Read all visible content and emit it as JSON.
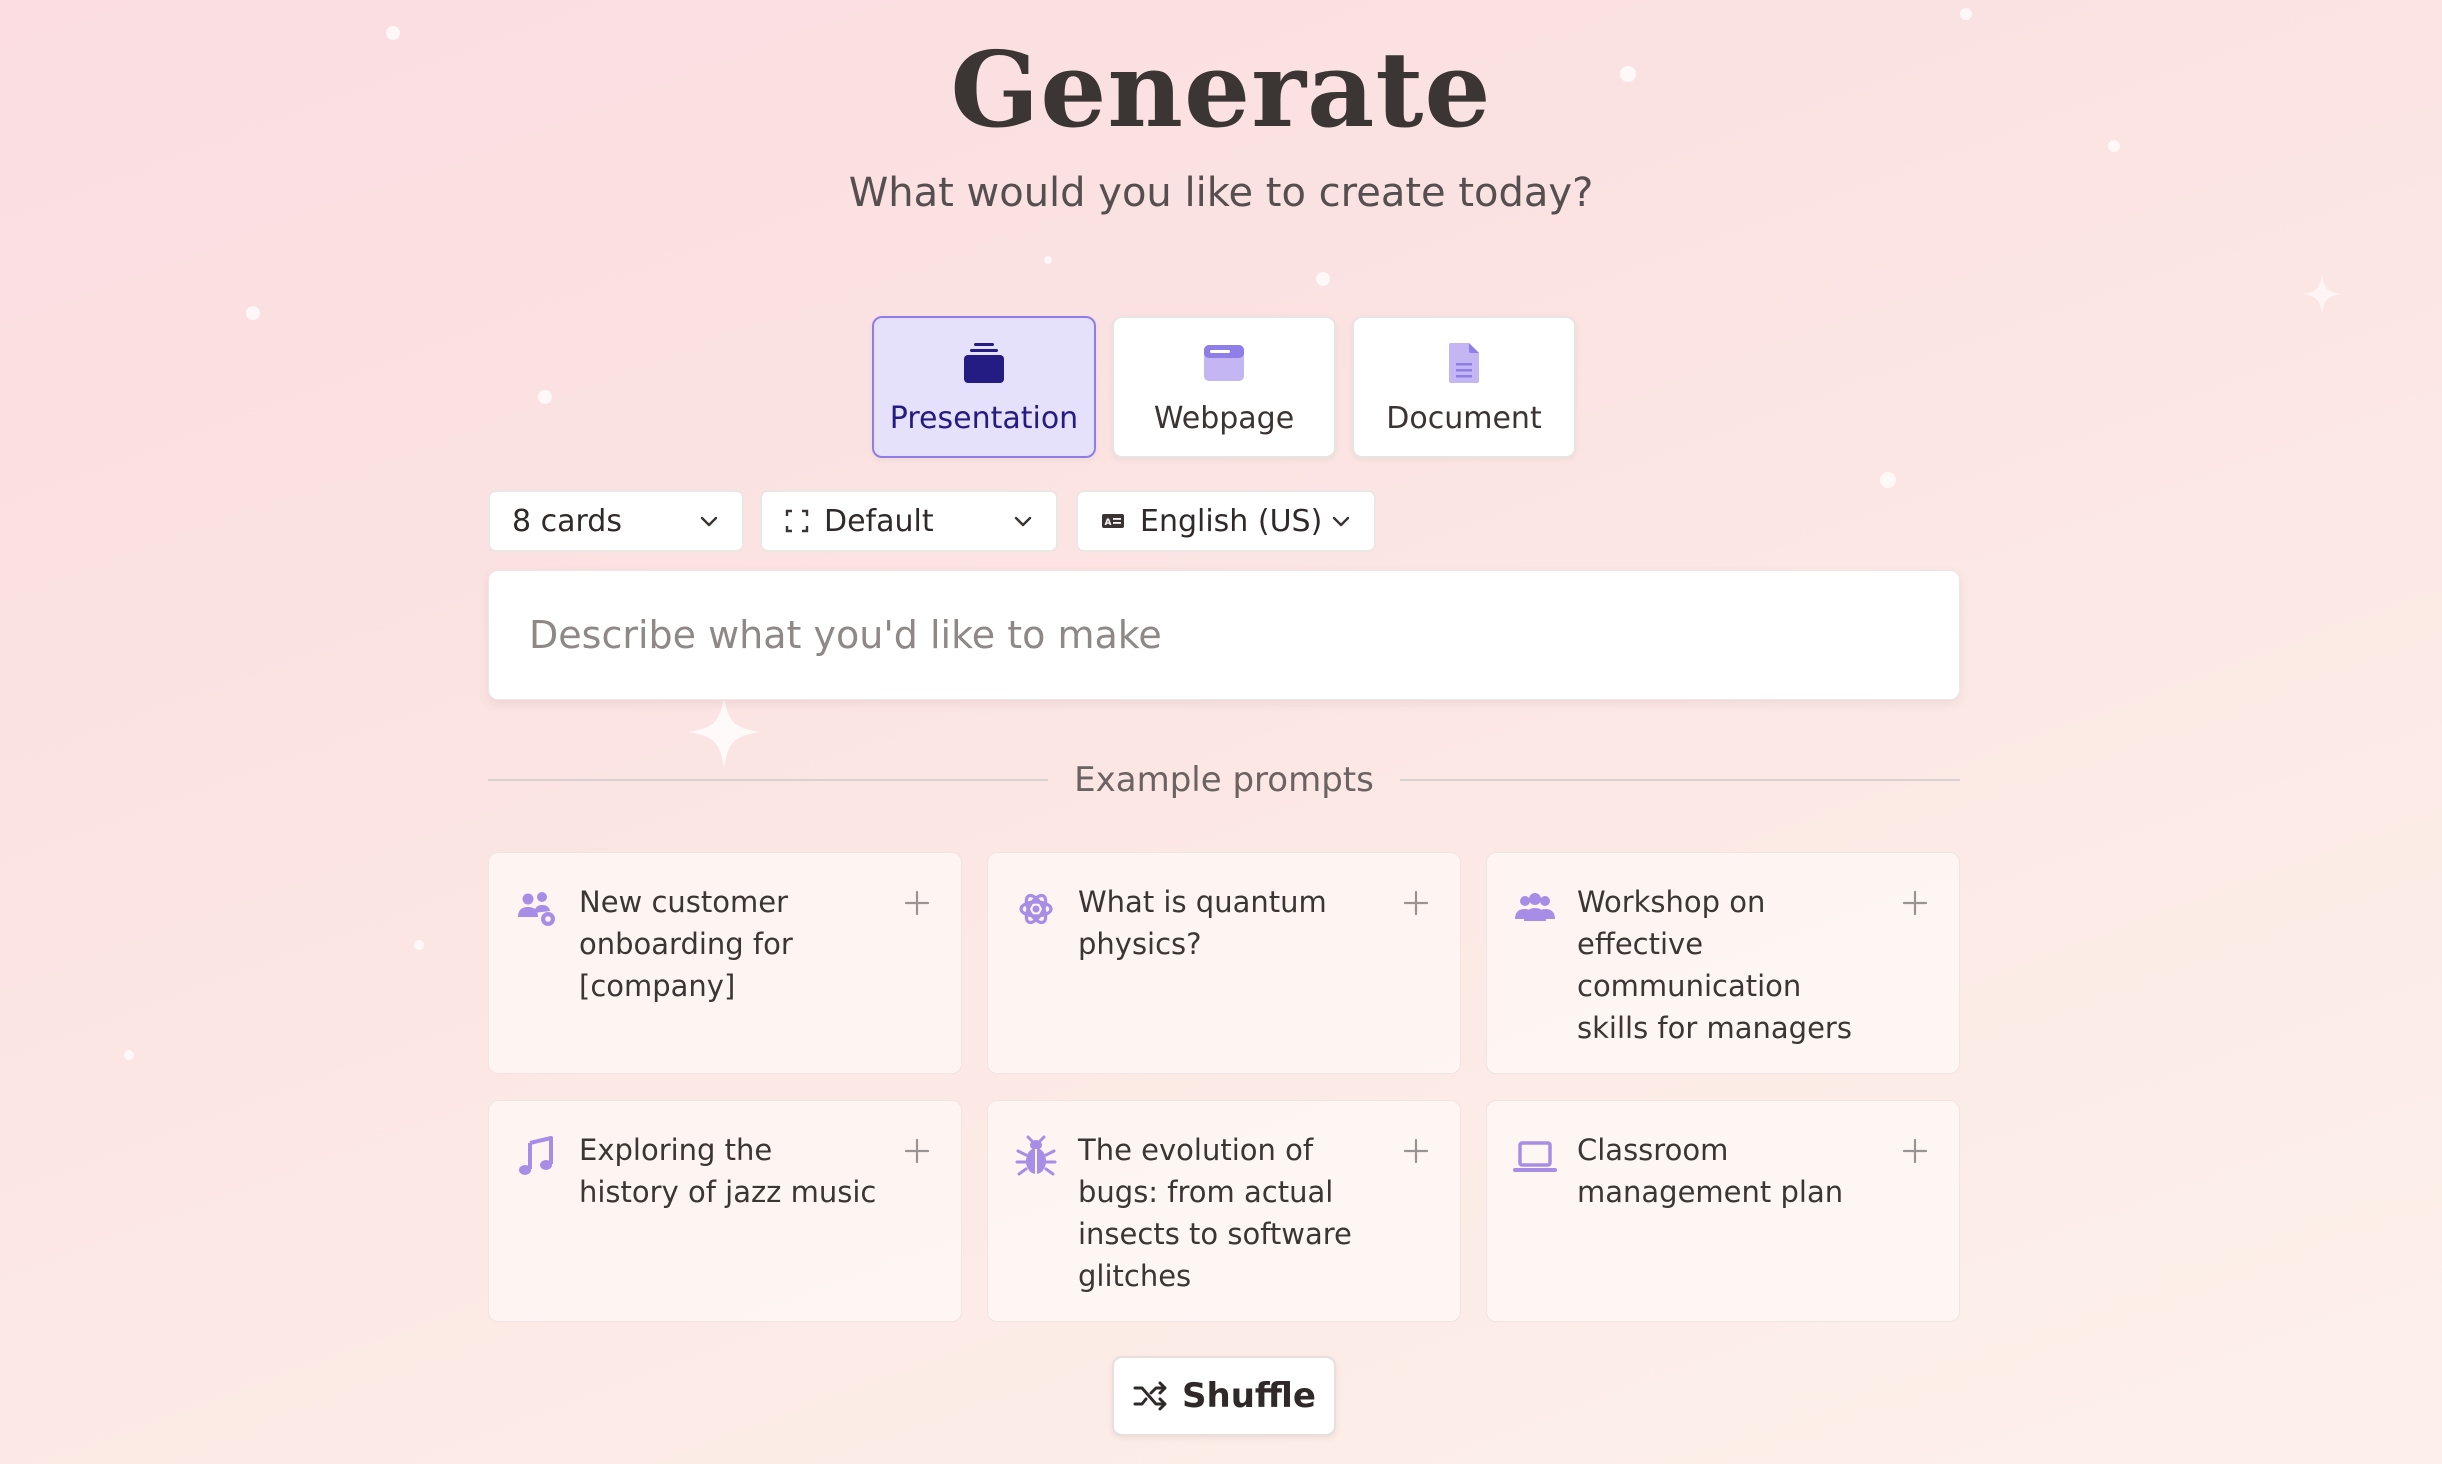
{
  "header": {
    "title": "Generate",
    "subtitle": "What would you like to create today?"
  },
  "content_types": [
    {
      "label": "Presentation",
      "icon": "stack-icon",
      "selected": true
    },
    {
      "label": "Webpage",
      "icon": "browser-window-icon",
      "selected": false
    },
    {
      "label": "Document",
      "icon": "document-icon",
      "selected": false
    }
  ],
  "options": {
    "cards": "8 cards",
    "theme": "Default",
    "language": "English (US)"
  },
  "prompt": {
    "placeholder": "Describe what you'd like to make",
    "value": ""
  },
  "examples": {
    "heading": "Example prompts",
    "items": [
      {
        "text": "New customer onboarding for [company]",
        "icon": "people-gear-icon"
      },
      {
        "text": "What is quantum physics?",
        "icon": "atom-icon"
      },
      {
        "text": "Workshop on effective communication skills for managers",
        "icon": "people-icon"
      },
      {
        "text": "Exploring the history of jazz music",
        "icon": "music-note-icon"
      },
      {
        "text": "The evolution of bugs: from actual insects to software glitches",
        "icon": "bug-icon"
      },
      {
        "text": "Classroom management plan",
        "icon": "laptop-icon"
      }
    ]
  },
  "shuffle": {
    "label": "Shuffle"
  },
  "colors": {
    "accent": "#8f7ee8",
    "accent_bg": "#e6e1fb",
    "icon_purple": "#a88de6",
    "active_text": "#241b83"
  }
}
